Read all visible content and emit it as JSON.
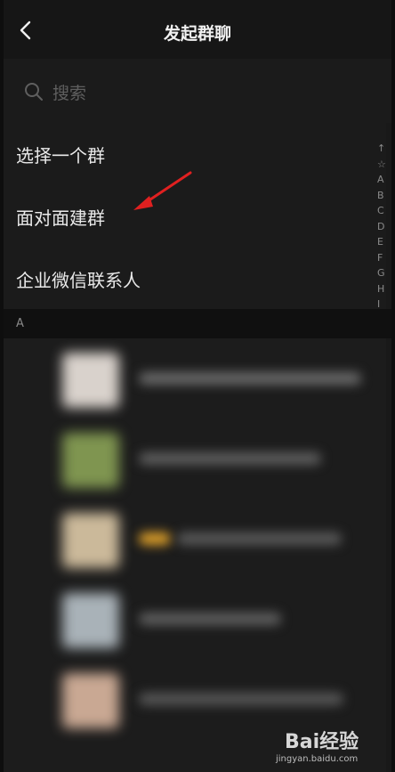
{
  "header": {
    "title": "发起群聊"
  },
  "search": {
    "placeholder": "搜索"
  },
  "menu": [
    {
      "label": "选择一个群"
    },
    {
      "label": "面对面建群"
    },
    {
      "label": "企业微信联系人"
    }
  ],
  "index": [
    "↑",
    "☆",
    "A",
    "B",
    "C",
    "D",
    "E",
    "F",
    "G",
    "H",
    "I"
  ],
  "section": {
    "label": "A"
  },
  "watermark": {
    "logo": "Bai经验",
    "url": "jingyan.baidu.com"
  },
  "colors": {
    "background": "#191919",
    "annotation_arrow": "#e02020"
  }
}
